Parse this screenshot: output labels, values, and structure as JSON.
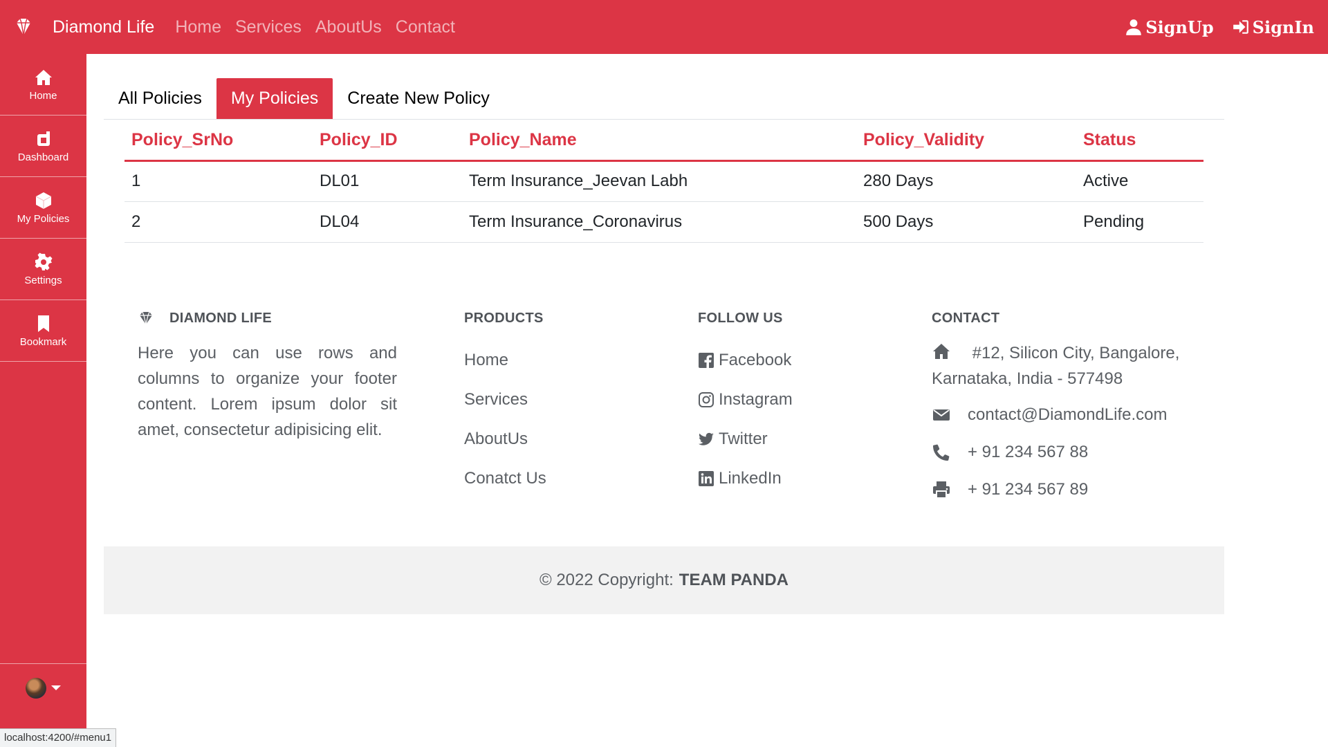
{
  "navbar": {
    "brand": "Diamond Life",
    "links": [
      "Home",
      "Services",
      "AboutUs",
      "Contact"
    ],
    "signup": "SignUp",
    "signin": "SignIn"
  },
  "sidebar": {
    "items": [
      {
        "label": "Home",
        "icon": "home-icon"
      },
      {
        "label": "Dashboard",
        "icon": "dashboard-icon"
      },
      {
        "label": "My Policies",
        "icon": "cube-icon"
      },
      {
        "label": "Settings",
        "icon": "gear-icon"
      },
      {
        "label": "Bookmark",
        "icon": "bookmark-icon"
      }
    ]
  },
  "tabs": [
    "All Policies",
    "My Policies",
    "Create New Policy"
  ],
  "active_tab": "My Policies",
  "table": {
    "headers": [
      "Policy_SrNo",
      "Policy_ID",
      "Policy_Name",
      "Policy_Validity",
      "Status"
    ],
    "rows": [
      [
        "1",
        "DL01",
        "Term Insurance_Jeevan Labh",
        "280 Days",
        "Active"
      ],
      [
        "2",
        "DL04",
        "Term Insurance_Coronavirus",
        "500 Days",
        "Pending"
      ]
    ]
  },
  "footer": {
    "brand_heading": "DIAMOND LIFE",
    "about_text": "Here you can use rows and columns to organize your footer content. Lorem ipsum dolor sit amet, consectetur adipisicing elit.",
    "products_heading": "PRODUCTS",
    "products": [
      "Home",
      "Services",
      "AboutUs",
      "Conatct Us"
    ],
    "follow_heading": "FOLLOW US",
    "follow": [
      "Facebook",
      "Instagram",
      "Twitter",
      "LinkedIn"
    ],
    "contact_heading": "CONTACT",
    "address": "#12, Silicon City, Bangalore, Karnataka, India - 577498",
    "email": "contact@DiamondLife.com",
    "phone": "+ 91 234 567 88",
    "fax": "+ 91 234 567 89"
  },
  "copyright": {
    "text": "© 2022 Copyright:",
    "team": "TEAM PANDA"
  },
  "status_url": "localhost:4200/#menu1",
  "colors": {
    "accent": "#dc3545",
    "footer_text": "#5b5f64",
    "footer_bg": "#f2f2f2"
  }
}
